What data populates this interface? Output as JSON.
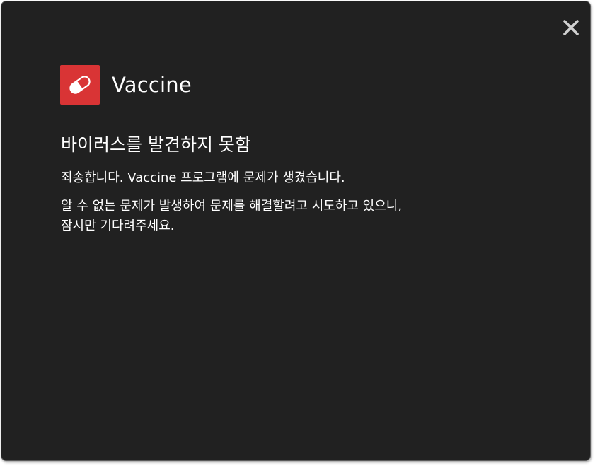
{
  "dialog": {
    "close_icon": "close-icon",
    "brand": {
      "icon": "pill-icon",
      "name": "Vaccine",
      "icon_color": "#d93435"
    },
    "heading": "바이러스를 발견하지 못함",
    "message_line1": "죄송합니다. Vaccine 프로그램에 문제가 생겼습니다.",
    "message_line2a": "알 수 없는 문제가 발생하여 문제를 해결할려고 시도하고 있으니,",
    "message_line2b": "잠시만 기다려주세요.",
    "background_color": "#212121",
    "text_color": "#ffffff"
  }
}
